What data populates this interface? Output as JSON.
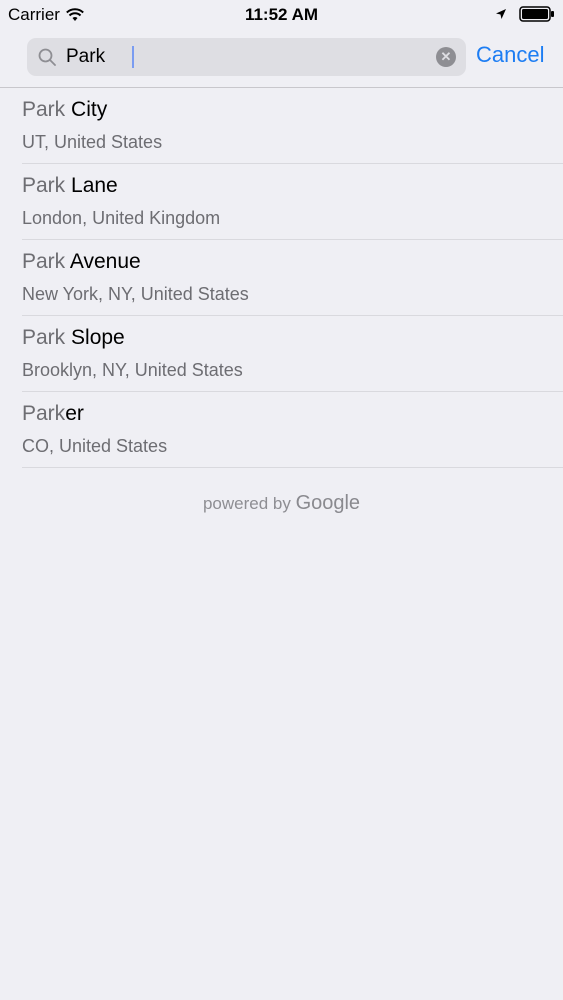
{
  "status_bar": {
    "carrier": "Carrier",
    "time": "11:52 AM"
  },
  "search": {
    "value": "Park",
    "cancel_label": "Cancel"
  },
  "results": [
    {
      "match": "Park",
      "rest": " City",
      "subtitle": "UT, United States"
    },
    {
      "match": "Park",
      "rest": " Lane",
      "subtitle": "London, United Kingdom"
    },
    {
      "match": "Park",
      "rest": " Avenue",
      "subtitle": "New York, NY, United States"
    },
    {
      "match": "Park",
      "rest": " Slope",
      "subtitle": "Brooklyn, NY, United States"
    },
    {
      "match": "Park",
      "rest": "er",
      "subtitle": "CO, United States"
    }
  ],
  "footer": {
    "powered_by": "powered by",
    "brand": "Google"
  },
  "colors": {
    "accent": "#1d7df3",
    "background": "#efeff4"
  }
}
